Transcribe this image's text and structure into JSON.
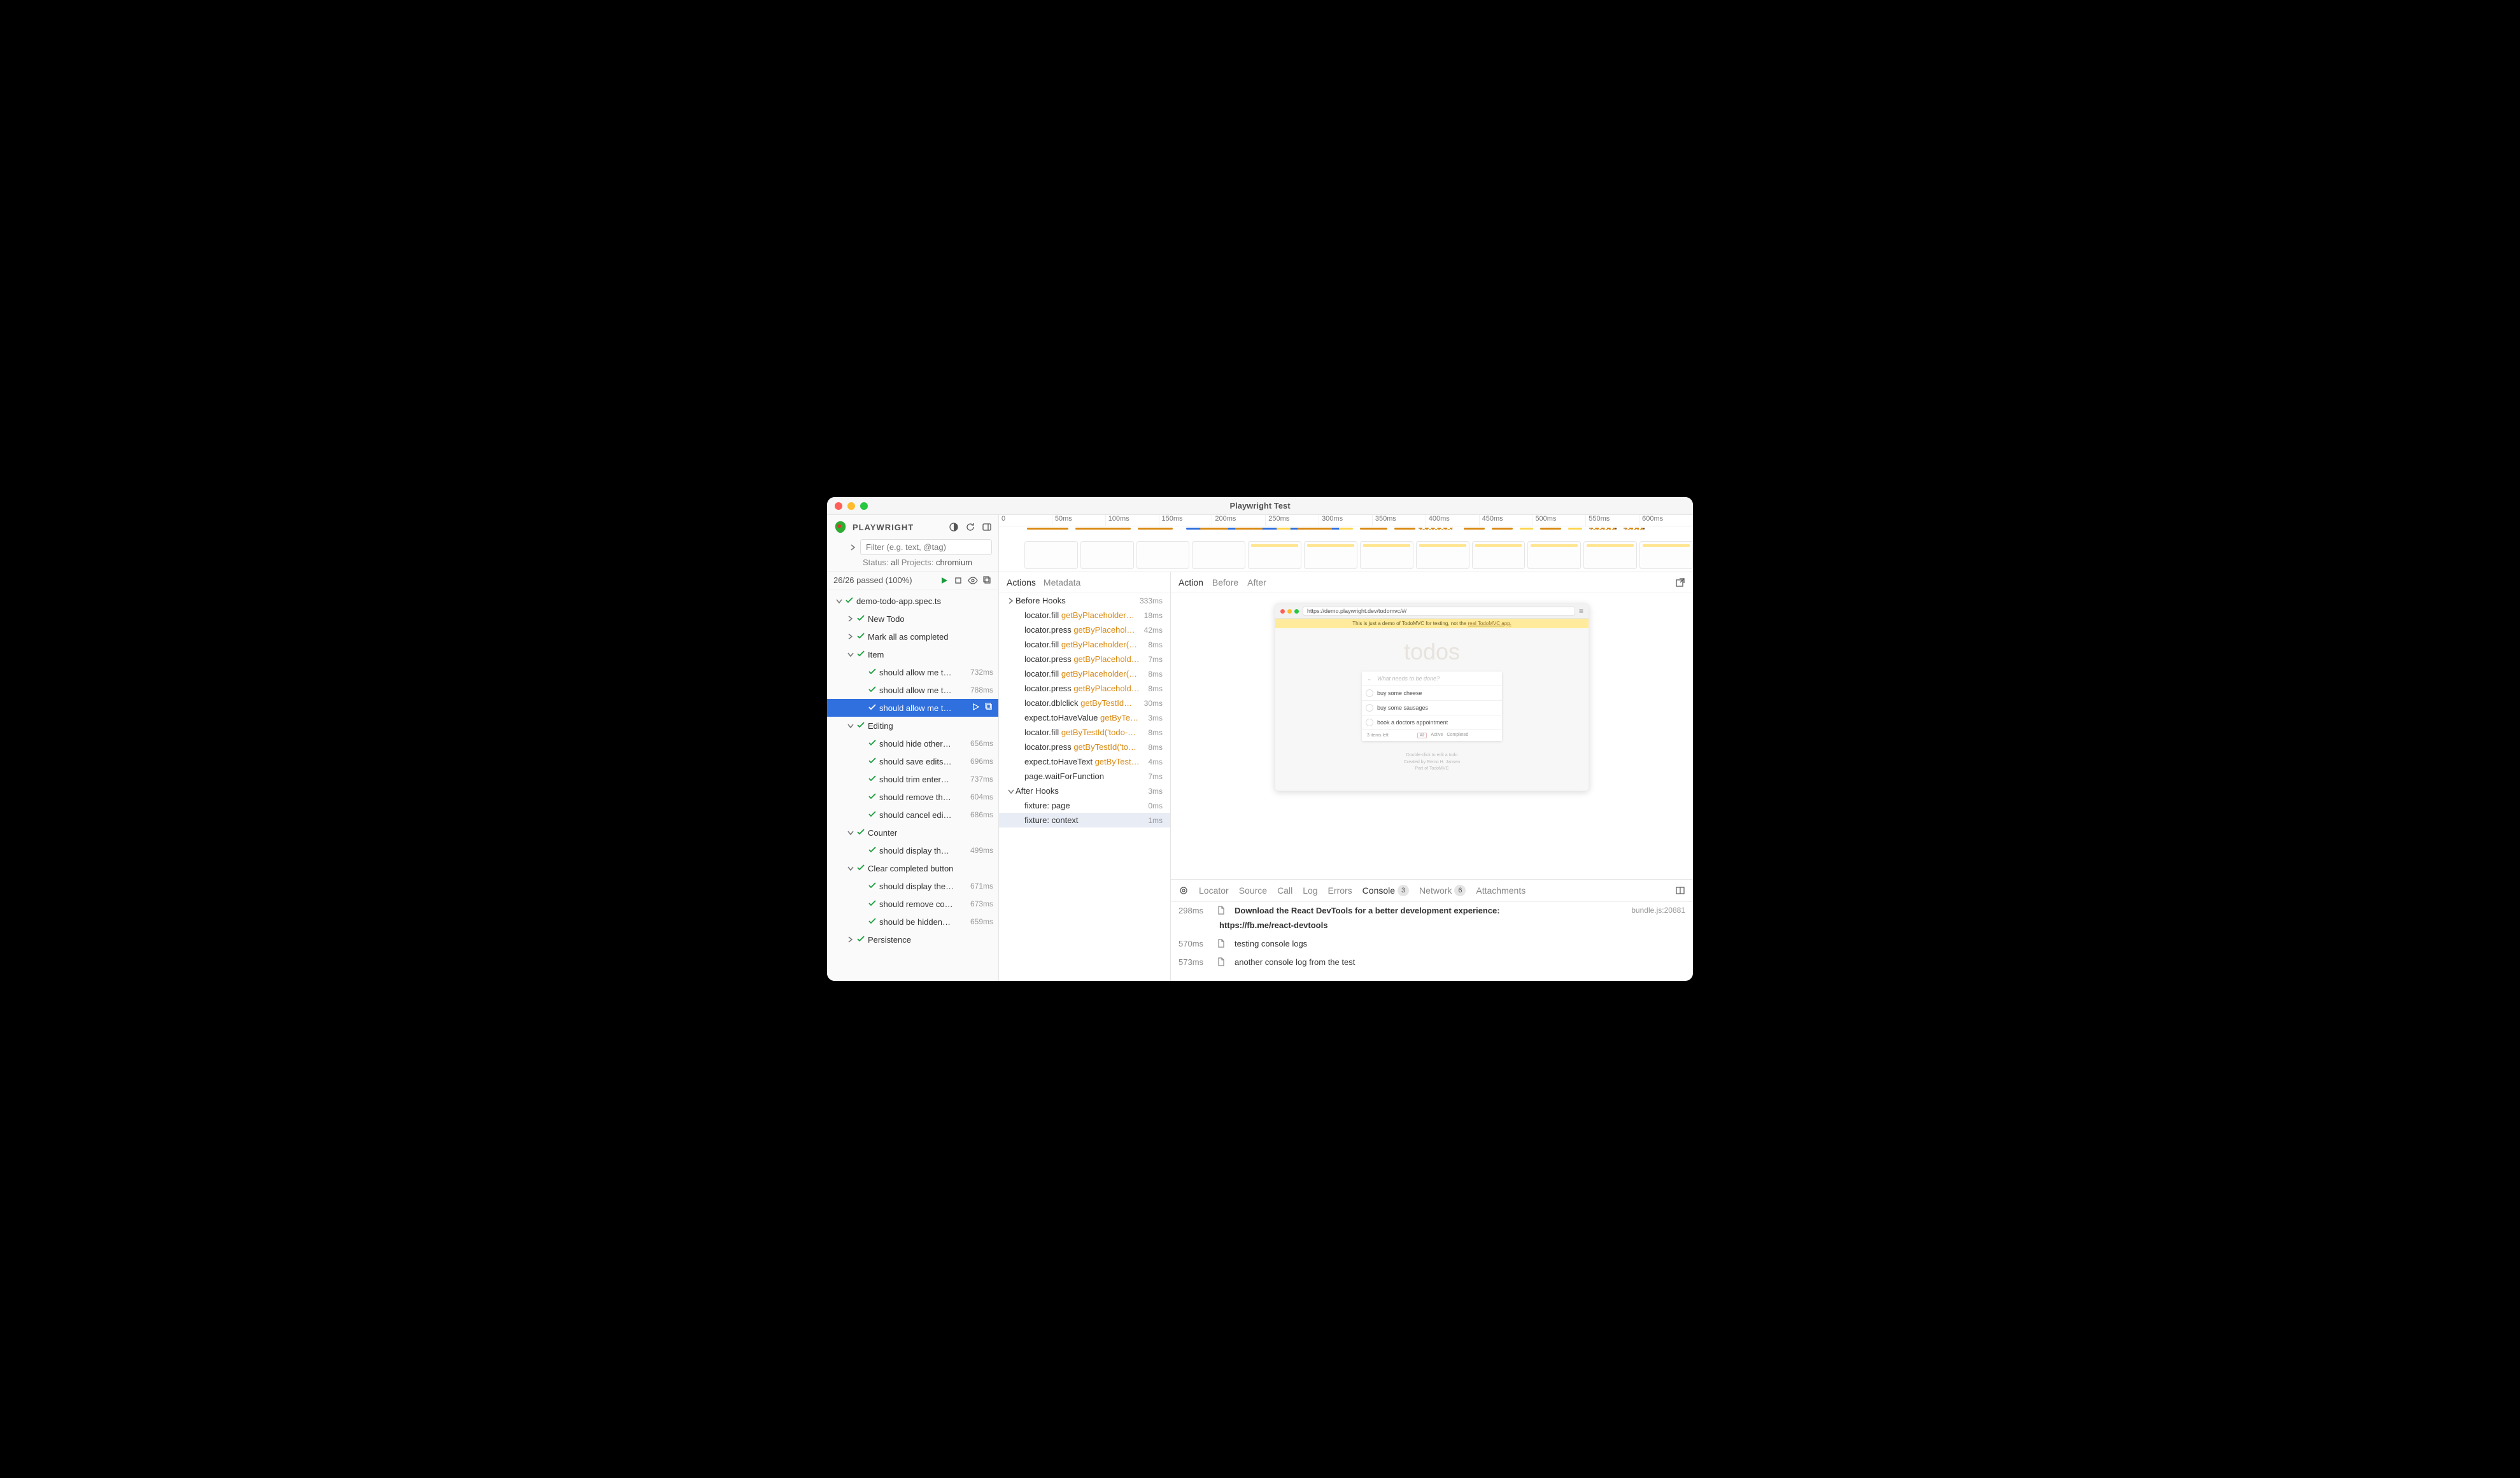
{
  "window": {
    "title": "Playwright Test"
  },
  "sidebar": {
    "brand": "PLAYWRIGHT",
    "filter_placeholder": "Filter (e.g. text, @tag)",
    "status_label": "Status:",
    "status_value": "all",
    "projects_label": "Projects:",
    "projects_value": "chromium",
    "summary": "26/26 passed (100%)"
  },
  "tree": [
    {
      "depth": 0,
      "toggle": "down",
      "label": "demo-todo-app.spec.ts",
      "dur": "",
      "pass": true
    },
    {
      "depth": 1,
      "toggle": "right",
      "label": "New Todo",
      "dur": "",
      "pass": true
    },
    {
      "depth": 1,
      "toggle": "right",
      "label": "Mark all as completed",
      "dur": "",
      "pass": true
    },
    {
      "depth": 1,
      "toggle": "down",
      "label": "Item",
      "dur": "",
      "pass": true
    },
    {
      "depth": 2,
      "toggle": "",
      "label": "should allow me t…",
      "dur": "732ms",
      "pass": true
    },
    {
      "depth": 2,
      "toggle": "",
      "label": "should allow me t…",
      "dur": "788ms",
      "pass": true
    },
    {
      "depth": 2,
      "toggle": "",
      "label": "should allow me t…",
      "dur": "",
      "pass": true,
      "selected": true
    },
    {
      "depth": 1,
      "toggle": "down",
      "label": "Editing",
      "dur": "",
      "pass": true
    },
    {
      "depth": 2,
      "toggle": "",
      "label": "should hide other…",
      "dur": "656ms",
      "pass": true
    },
    {
      "depth": 2,
      "toggle": "",
      "label": "should save edits…",
      "dur": "696ms",
      "pass": true
    },
    {
      "depth": 2,
      "toggle": "",
      "label": "should trim enter…",
      "dur": "737ms",
      "pass": true
    },
    {
      "depth": 2,
      "toggle": "",
      "label": "should remove th…",
      "dur": "604ms",
      "pass": true
    },
    {
      "depth": 2,
      "toggle": "",
      "label": "should cancel edi…",
      "dur": "686ms",
      "pass": true
    },
    {
      "depth": 1,
      "toggle": "down",
      "label": "Counter",
      "dur": "",
      "pass": true
    },
    {
      "depth": 2,
      "toggle": "",
      "label": "should display th…",
      "dur": "499ms",
      "pass": true
    },
    {
      "depth": 1,
      "toggle": "down",
      "label": "Clear completed button",
      "dur": "",
      "pass": true
    },
    {
      "depth": 2,
      "toggle": "",
      "label": "should display the…",
      "dur": "671ms",
      "pass": true
    },
    {
      "depth": 2,
      "toggle": "",
      "label": "should remove co…",
      "dur": "673ms",
      "pass": true
    },
    {
      "depth": 2,
      "toggle": "",
      "label": "should be hidden…",
      "dur": "659ms",
      "pass": true
    },
    {
      "depth": 1,
      "toggle": "right",
      "label": "Persistence",
      "dur": "",
      "pass": true
    }
  ],
  "timeline": {
    "ticks": [
      "0",
      "50ms",
      "100ms",
      "150ms",
      "200ms",
      "250ms",
      "300ms",
      "350ms",
      "400ms",
      "450ms",
      "500ms",
      "550ms",
      "600ms"
    ]
  },
  "actions_tabs": {
    "actions": "Actions",
    "metadata": "Metadata"
  },
  "actions": [
    {
      "toggle": "right",
      "indent": 0,
      "pre": "Before Hooks",
      "hl": "",
      "dur": "333ms"
    },
    {
      "toggle": "",
      "indent": 1,
      "pre": "locator.fill ",
      "hl": "getByPlaceholder…",
      "dur": "18ms"
    },
    {
      "toggle": "",
      "indent": 1,
      "pre": "locator.press ",
      "hl": "getByPlacehol…",
      "dur": "42ms"
    },
    {
      "toggle": "",
      "indent": 1,
      "pre": "locator.fill ",
      "hl": "getByPlaceholder(…",
      "dur": "8ms"
    },
    {
      "toggle": "",
      "indent": 1,
      "pre": "locator.press ",
      "hl": "getByPlacehold…",
      "dur": "7ms"
    },
    {
      "toggle": "",
      "indent": 1,
      "pre": "locator.fill ",
      "hl": "getByPlaceholder(…",
      "dur": "8ms"
    },
    {
      "toggle": "",
      "indent": 1,
      "pre": "locator.press ",
      "hl": "getByPlacehold…",
      "dur": "8ms"
    },
    {
      "toggle": "",
      "indent": 1,
      "pre": "locator.dblclick ",
      "hl": "getByTestId…",
      "dur": "30ms"
    },
    {
      "toggle": "",
      "indent": 1,
      "pre": "expect.toHaveValue ",
      "hl": "getByTe…",
      "dur": "3ms"
    },
    {
      "toggle": "",
      "indent": 1,
      "pre": "locator.fill ",
      "hl": "getByTestId('todo-…",
      "dur": "8ms"
    },
    {
      "toggle": "",
      "indent": 1,
      "pre": "locator.press ",
      "hl": "getByTestId('to…",
      "dur": "8ms"
    },
    {
      "toggle": "",
      "indent": 1,
      "pre": "expect.toHaveText ",
      "hl": "getByTest…",
      "dur": "4ms"
    },
    {
      "toggle": "",
      "indent": 1,
      "pre": "page.waitForFunction",
      "hl": "",
      "dur": "7ms"
    },
    {
      "toggle": "down",
      "indent": 0,
      "pre": "After Hooks",
      "hl": "",
      "dur": "3ms"
    },
    {
      "toggle": "",
      "indent": 1,
      "pre": "fixture: page",
      "hl": "",
      "dur": "0ms"
    },
    {
      "toggle": "",
      "indent": 1,
      "pre": "fixture: context",
      "hl": "",
      "dur": "1ms",
      "sel": true
    }
  ],
  "preview_tabs": {
    "action": "Action",
    "before": "Before",
    "after": "After"
  },
  "preview": {
    "url": "https://demo.playwright.dev/todomvc/#/",
    "banner_pre": "This is just a demo of TodoMVC for testing, not the ",
    "banner_link": "real TodoMVC app.",
    "heading": "todos",
    "input_placeholder": "What needs to be done?",
    "items": [
      "buy some cheese",
      "buy some sausages",
      "book a doctors appointment"
    ],
    "footer_left": "3 items left",
    "footer_filters": [
      "All",
      "Active",
      "Completed"
    ],
    "credit1": "Double-click to edit a todo",
    "credit2": "Created by Remo H. Jansen",
    "credit3": "Part of TodoMVC"
  },
  "bottom_tabs": {
    "locator": "Locator",
    "source": "Source",
    "call": "Call",
    "log": "Log",
    "errors": "Errors",
    "console": "Console",
    "console_badge": "3",
    "network": "Network",
    "network_badge": "6",
    "attachments": "Attachments"
  },
  "console": [
    {
      "ts": "298ms",
      "msg": "Download the React DevTools for a better development experience:",
      "bold": true,
      "src": "bundle.js:20881"
    },
    {
      "link": "https://fb.me/react-devtools"
    },
    {
      "ts": "570ms",
      "msg": "testing console logs"
    },
    {
      "ts": "573ms",
      "msg": "another console log from the test"
    }
  ]
}
